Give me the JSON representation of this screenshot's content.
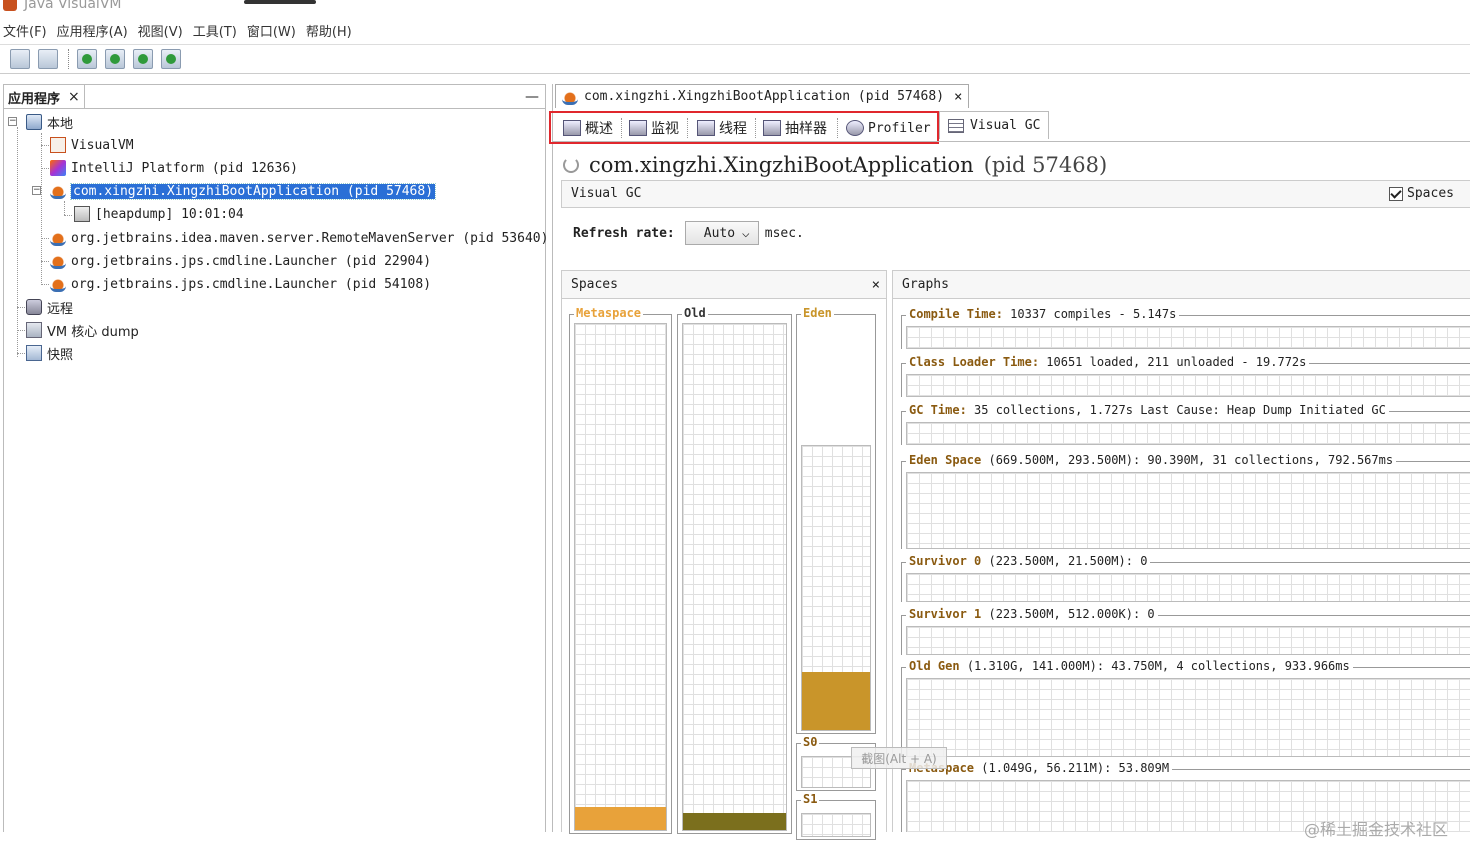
{
  "window": {
    "title": "Java VisualVM"
  },
  "menu": [
    "文件(F)",
    "应用程序(A)",
    "视图(V)",
    "工具(T)",
    "窗口(W)",
    "帮助(H)"
  ],
  "left_panel": {
    "tab_label": "应用程序",
    "close": "×",
    "minimize": "—",
    "tree": {
      "local": "本地",
      "visualvm": "VisualVM",
      "intellij": "IntelliJ Platform (pid 12636)",
      "xingzhi": "com.xingzhi.XingzhiBootApplication (pid 57468)",
      "heapdump": "[heapdump] 10:01:04",
      "maven": "org.jetbrains.idea.maven.server.RemoteMavenServer (pid 53640)",
      "jps1": "org.jetbrains.jps.cmdline.Launcher (pid 22904)",
      "jps2": "org.jetbrains.jps.cmdline.Launcher (pid 54108)",
      "remote": "远程",
      "core": "VM 核心 dump",
      "snapshot": "快照"
    }
  },
  "right_panel": {
    "doc_tab": "com.xingzhi.XingzhiBootApplication (pid 57468)",
    "doc_tab_close": "×",
    "subtabs": [
      "概述",
      "监视",
      "线程",
      "抽样器",
      "Profiler"
    ],
    "visual_gc_tab": "Visual GC",
    "heading": {
      "name": "com.xingzhi.XingzhiBootApplication",
      "pid": "(pid 57468)"
    },
    "vgc_title": "Visual GC",
    "spaces_checkbox": "Spaces",
    "refresh": {
      "label": "Refresh rate:",
      "value": "Auto",
      "unit": "msec."
    },
    "spaces_panel": {
      "title": "Spaces",
      "close": "×",
      "columns": [
        {
          "label": "Metaspace",
          "fill_fraction": 0.045,
          "color": "#e8a23a",
          "label_color": "#e8a23a"
        },
        {
          "label": "Old",
          "fill_fraction": 0.033,
          "color": "#7b6f1d",
          "label_color": "#333333"
        },
        {
          "label": "Eden",
          "fill_fraction": 0.203,
          "color": "#c9952a",
          "label_color": "#c9952a"
        },
        {
          "label": "S0",
          "fill_fraction": 0.0,
          "color": "#c9952a",
          "label_color": "#8a5a10"
        },
        {
          "label": "S1",
          "fill_fraction": 0.0,
          "color": "#c9952a",
          "label_color": "#8a5a10"
        }
      ]
    },
    "graphs_panel": {
      "title": "Graphs",
      "graphs": [
        {
          "label": "Compile Time:",
          "value": "10337 compiles - 5.147s"
        },
        {
          "label": "Class Loader Time:",
          "value": "10651 loaded, 211 unloaded - 19.772s"
        },
        {
          "label": "GC Time:",
          "value": "35 collections, 1.727s  Last Cause: Heap Dump Initiated GC"
        },
        {
          "label": "Eden Space",
          "value": "(669.500M, 293.500M): 90.390M, 31 collections, 792.567ms"
        },
        {
          "label": "Survivor 0",
          "value": "(223.500M, 21.500M): 0"
        },
        {
          "label": "Survivor 1",
          "value": "(223.500M, 512.000K): 0"
        },
        {
          "label": "Old Gen",
          "value": "(1.310G, 141.000M): 43.750M, 4 collections, 933.966ms"
        },
        {
          "label": "Metaspace",
          "value": "(1.049G, 56.211M): 53.809M"
        }
      ]
    },
    "tooltip": "截图(Alt + A)"
  },
  "watermark": "@稀土掘金技术社区",
  "colors": {
    "selection": "#2a6fd6",
    "highlight_box": "#e0272d"
  }
}
